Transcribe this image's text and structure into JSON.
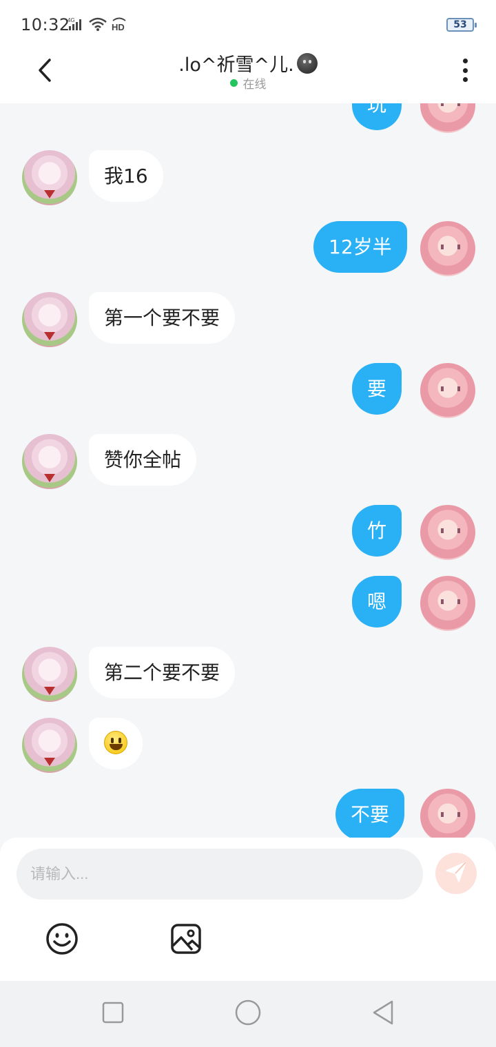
{
  "status_bar": {
    "time": "10:32",
    "network": "4G",
    "hd_label": "HD",
    "battery": "53"
  },
  "header": {
    "title": ".lo^祈雪^儿.",
    "status": "在线",
    "back_icon": "chevron-left-icon",
    "more_icon": "more-vertical-icon"
  },
  "messages": [
    {
      "side": "right",
      "text": "玩"
    },
    {
      "side": "left",
      "text": "我16"
    },
    {
      "side": "right",
      "text": "12岁半"
    },
    {
      "side": "left",
      "text": "第一个要不要"
    },
    {
      "side": "right",
      "text": "要"
    },
    {
      "side": "left",
      "text": "赞你全帖"
    },
    {
      "side": "right",
      "text": "竹"
    },
    {
      "side": "right",
      "text": "嗯"
    },
    {
      "side": "left",
      "text": "第二个要不要"
    },
    {
      "side": "left",
      "text": "",
      "emoji": "grinning-face"
    },
    {
      "side": "right",
      "text": "不要"
    }
  ],
  "composer": {
    "placeholder": "请输入...",
    "value": "",
    "send_icon": "send-icon",
    "emoji_icon": "smiley-icon",
    "image_icon": "image-icon"
  },
  "colors": {
    "own_bubble": "#2ab0f5",
    "peer_bubble": "#ffffff",
    "background": "#f4f6f7",
    "online": "#22c55e",
    "send_button": "#fde2dc"
  }
}
